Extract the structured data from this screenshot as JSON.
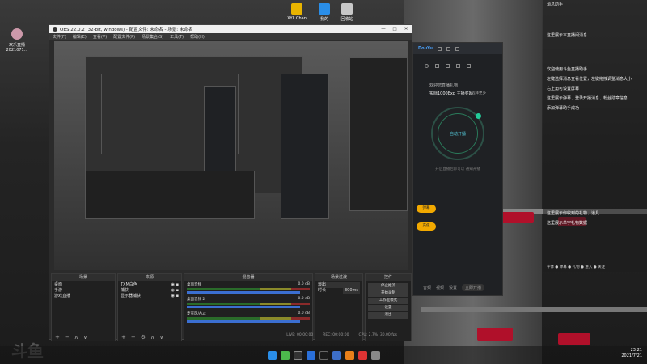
{
  "desktop": {
    "icons": [
      {
        "label": "XYL Chan",
        "color": "#e8b400"
      },
      {
        "label": "我的",
        "color": "#2a8ee8"
      },
      {
        "label": "回收站",
        "color": "#c8c8c8"
      }
    ],
    "left_user": {
      "name": "欢乐直播",
      "date": "2021071..."
    },
    "watermark": "斗鱼"
  },
  "obs": {
    "title": "OBS 22.0.2 (32-bit, windows) - 配置文件: 未命名 - 场景: 未命名",
    "window_controls": [
      "—",
      "□",
      "✕"
    ],
    "menu": [
      "文件(F)",
      "编辑(E)",
      "查看(V)",
      "配置文件(P)",
      "场景集合(S)",
      "工具(T)",
      "帮助(H)"
    ],
    "docks": {
      "scenes": {
        "title": "场景",
        "items": [
          "桌面",
          "手游",
          "游戏直播"
        ]
      },
      "sources": {
        "title": "来源",
        "items": [
          "TXM白色",
          "捕获",
          "显示器捕获"
        ]
      },
      "mixer": {
        "title": "混音器",
        "rows": [
          {
            "name": "桌面音频",
            "db": "0.0 dB"
          },
          {
            "name": "桌面音频 2",
            "db": "0.0 dB"
          },
          {
            "name": "麦克风/Aux",
            "db": "0.0 dB"
          }
        ]
      },
      "transitions": {
        "title": "场景过渡",
        "type": "淡出",
        "duration_label": "时长",
        "duration": "300ms"
      },
      "controls": {
        "title": "控件",
        "buttons": [
          "停止推流",
          "开始录制",
          "工作室模式",
          "设置",
          "退出"
        ]
      }
    },
    "status": {
      "live": "LIVE: 00:00:00",
      "rec": "REC: 00:00:00",
      "cpu": "CPU: 2.7%, 30.00 fps"
    },
    "dock_footer_symbols": [
      "+",
      "−",
      "⚙",
      "∧",
      "∨"
    ]
  },
  "app": {
    "brand": "DouYu",
    "hero_title": "欢迎您直播礼物",
    "hero_sub": "实际1000Exp 主播奖励",
    "hero_badge": "选择更多",
    "ring_label": "自动开播",
    "hint": "开启直播后即可以 通知开播",
    "pills": [
      "弹幕",
      "充值"
    ],
    "footer": [
      "音频",
      "视频",
      "设置",
      "立即开播"
    ]
  },
  "chat": {
    "header": "消息助手",
    "messages": [
      "这里展示本直播间消息",
      "欢迎使用斗鱼直播助手",
      "左键选择消息查看位置，左键拖拽调整消息大小",
      "右上角可设置屏幕",
      "这里展示弹幕、登录开播消息、粉丝勋章信息",
      "添加弹幕助手成功",
      "这里展示你收到的礼物、道具",
      "这里展示单字礼物数据"
    ],
    "tools": "字体 ● 弹幕 ● 礼物 ● 进入 ● 关注"
  },
  "taskbar": {
    "clock_time": "23:21",
    "clock_date": "2021/7/21"
  },
  "colors": {
    "accent": "#4aa3ff",
    "live_green": "#2c9",
    "pill": "#f2a900"
  }
}
